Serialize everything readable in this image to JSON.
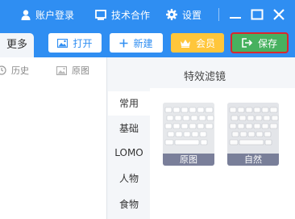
{
  "titlebar": {
    "account_login": "账户登录",
    "tech_cooperation": "技术合作",
    "settings": "设置",
    "icons": [
      "user-icon",
      "monitor-icon",
      "gear-icon",
      "minimize-icon",
      "maximize-icon",
      "close-icon"
    ]
  },
  "toolbar": {
    "more_tab": "更多",
    "open_label": "打开",
    "new_label": "新建",
    "vip_label": "会员",
    "save_label": "保存"
  },
  "left_panel": {
    "history_label": "历史",
    "original_label": "原图"
  },
  "filters": {
    "title": "特效滤镜",
    "categories": [
      "常用",
      "基础",
      "LOMO",
      "人物",
      "食物"
    ],
    "active_category": "常用",
    "thumbnails": [
      {
        "label": "原图"
      },
      {
        "label": "自然"
      }
    ]
  },
  "colors": {
    "brand_blue": "#2f8ef2",
    "save_green": "#47b15f",
    "vip_gold": "#ffc63b",
    "highlight_red": "#d9272e"
  }
}
